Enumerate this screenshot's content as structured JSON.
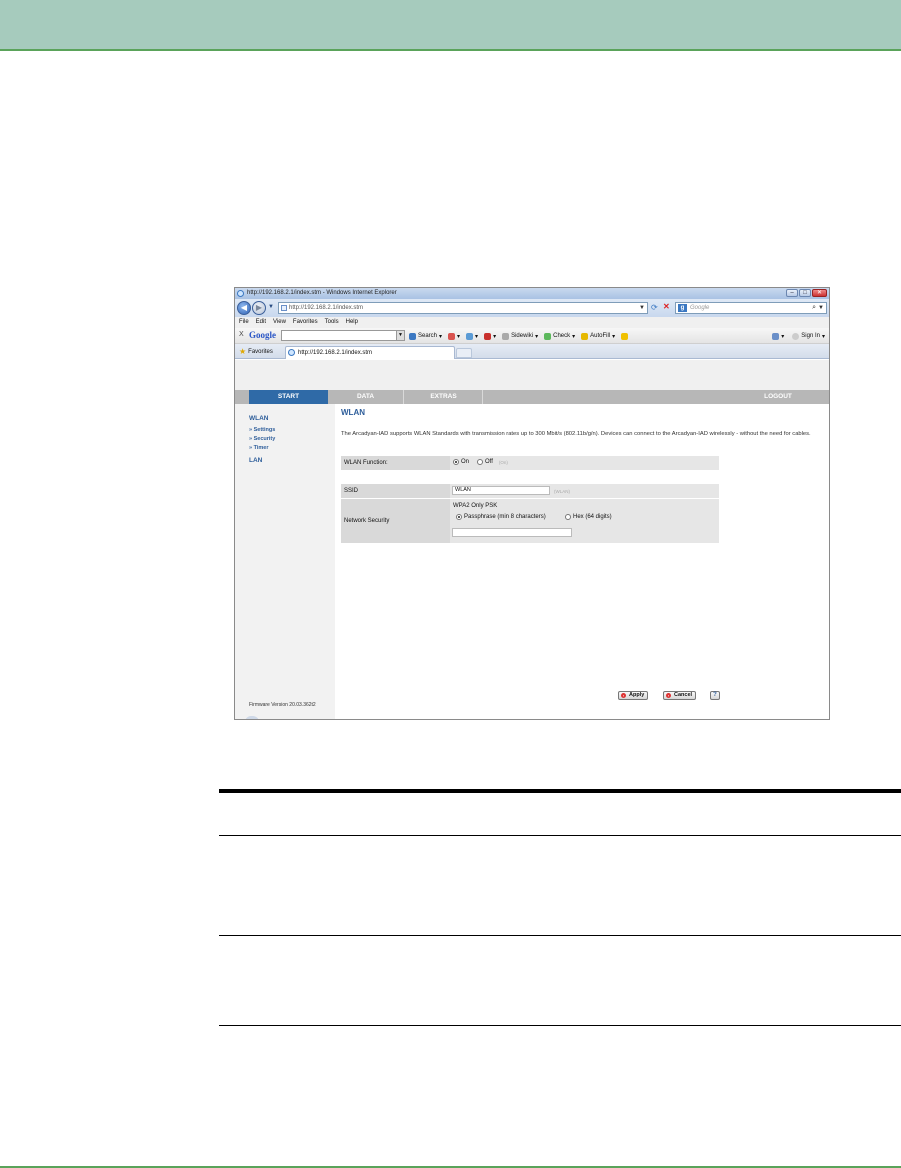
{
  "browser": {
    "title": "http://192.168.2.1/index.stm - Windows Internet Explorer",
    "address": "http://192.168.2.1/index.stm",
    "search_placeholder": "Google",
    "menu": [
      "File",
      "Edit",
      "View",
      "Favorites",
      "Tools",
      "Help"
    ],
    "google_toolbar": {
      "close": "X",
      "logo": "Google",
      "search_label": "Search",
      "sidewiki_label": "Sidewiki",
      "check_label": "Check",
      "autofill_label": "AutoFill",
      "signin_label": "Sign In"
    },
    "favorites_label": "Favorites",
    "tab_title": "http://192.168.2.1/index.stm"
  },
  "router": {
    "nav": {
      "start": "START",
      "data": "DATA",
      "extras": "EXTRAS",
      "logout": "LOGOUT"
    },
    "sidebar": {
      "wlan": "WLAN",
      "settings": "» Settings",
      "security": "» Security",
      "timer": "» Timer",
      "lan": "LAN",
      "firmware": "Firmware Version 20.03.362t2"
    },
    "content": {
      "title": "WLAN",
      "description": "The Arcadyan-IAD supports WLAN Standards with transmission rates up to 300 Mbit/s (802.11b/g/n). Devices can connect to the Arcadyan-IAD wirelessly - without the need for cables.",
      "wlan_function_label": "WLAN Function:",
      "on_label": "On",
      "off_label": "Off",
      "on_hint": "(On)",
      "ssid_label": "SSID",
      "ssid_value": "WLAN",
      "ssid_hint": "(WLAN)",
      "network_security_label": "Network Security",
      "security_mode": "WPA2 Only PSK",
      "passphrase_option": "Passphrase (min 8 characters)",
      "hex_option": "Hex (64 digits)",
      "passphrase_value": "",
      "apply_label": "Apply",
      "cancel_label": "Cancel",
      "help_label": "?"
    }
  },
  "colors": {
    "header_band": "#a6cbbd",
    "accent_line": "#5aa35a",
    "nav_active": "#2f6aa7",
    "link_blue": "#2d5d9a"
  }
}
